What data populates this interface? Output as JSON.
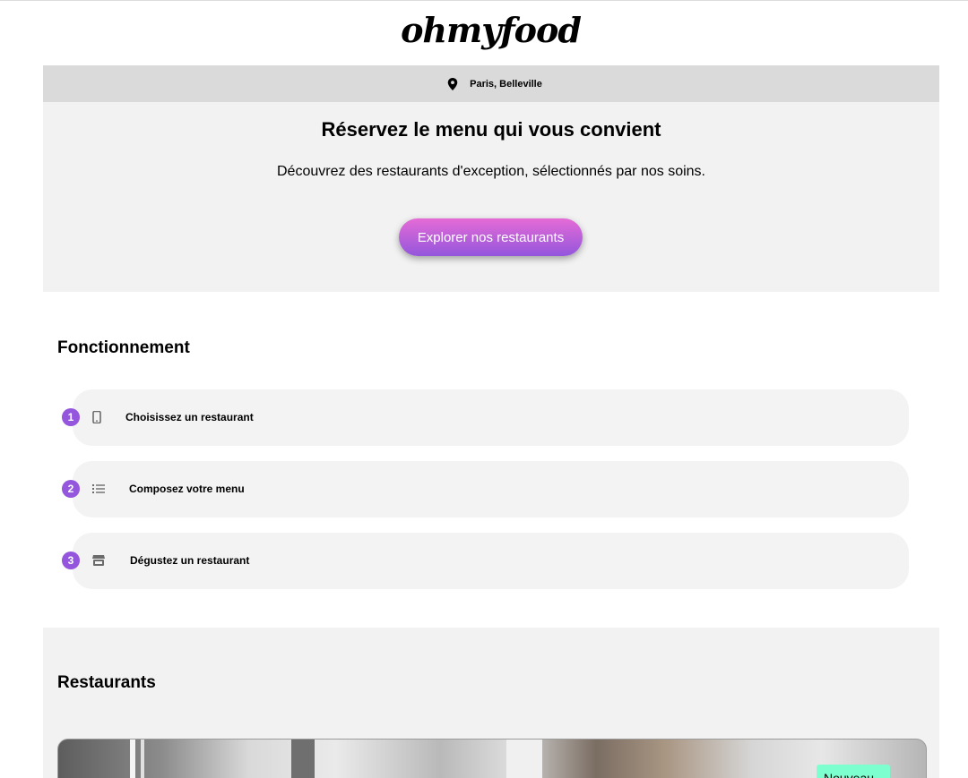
{
  "header": {
    "logo": "ohmyfood"
  },
  "location": {
    "icon": "location-pin-icon",
    "label": "Paris, Belleville"
  },
  "hero": {
    "title": "Réservez le menu qui vous convient",
    "subtitle": "Découvrez des restaurants d'exception, sélectionnés par nos soins.",
    "cta_label": "Explorer nos restaurants"
  },
  "how_it_works": {
    "title": "Fonctionnement",
    "steps": [
      {
        "number": "1",
        "icon": "mobile-phone-icon",
        "label": "Choisissez un restaurant"
      },
      {
        "number": "2",
        "icon": "list-icon",
        "label": "Composez votre menu"
      },
      {
        "number": "3",
        "icon": "store-icon",
        "label": "Dégustez un restaurant"
      }
    ]
  },
  "restaurants": {
    "title": "Restaurants",
    "first_card": {
      "badge": "Nouveau"
    }
  },
  "colors": {
    "accent_purple": "#9356dc",
    "accent_pink": "#e56bd6",
    "badge_green": "#7dffd0",
    "location_bar_bg": "#dadada",
    "section_bg": "#f2f2f2"
  }
}
